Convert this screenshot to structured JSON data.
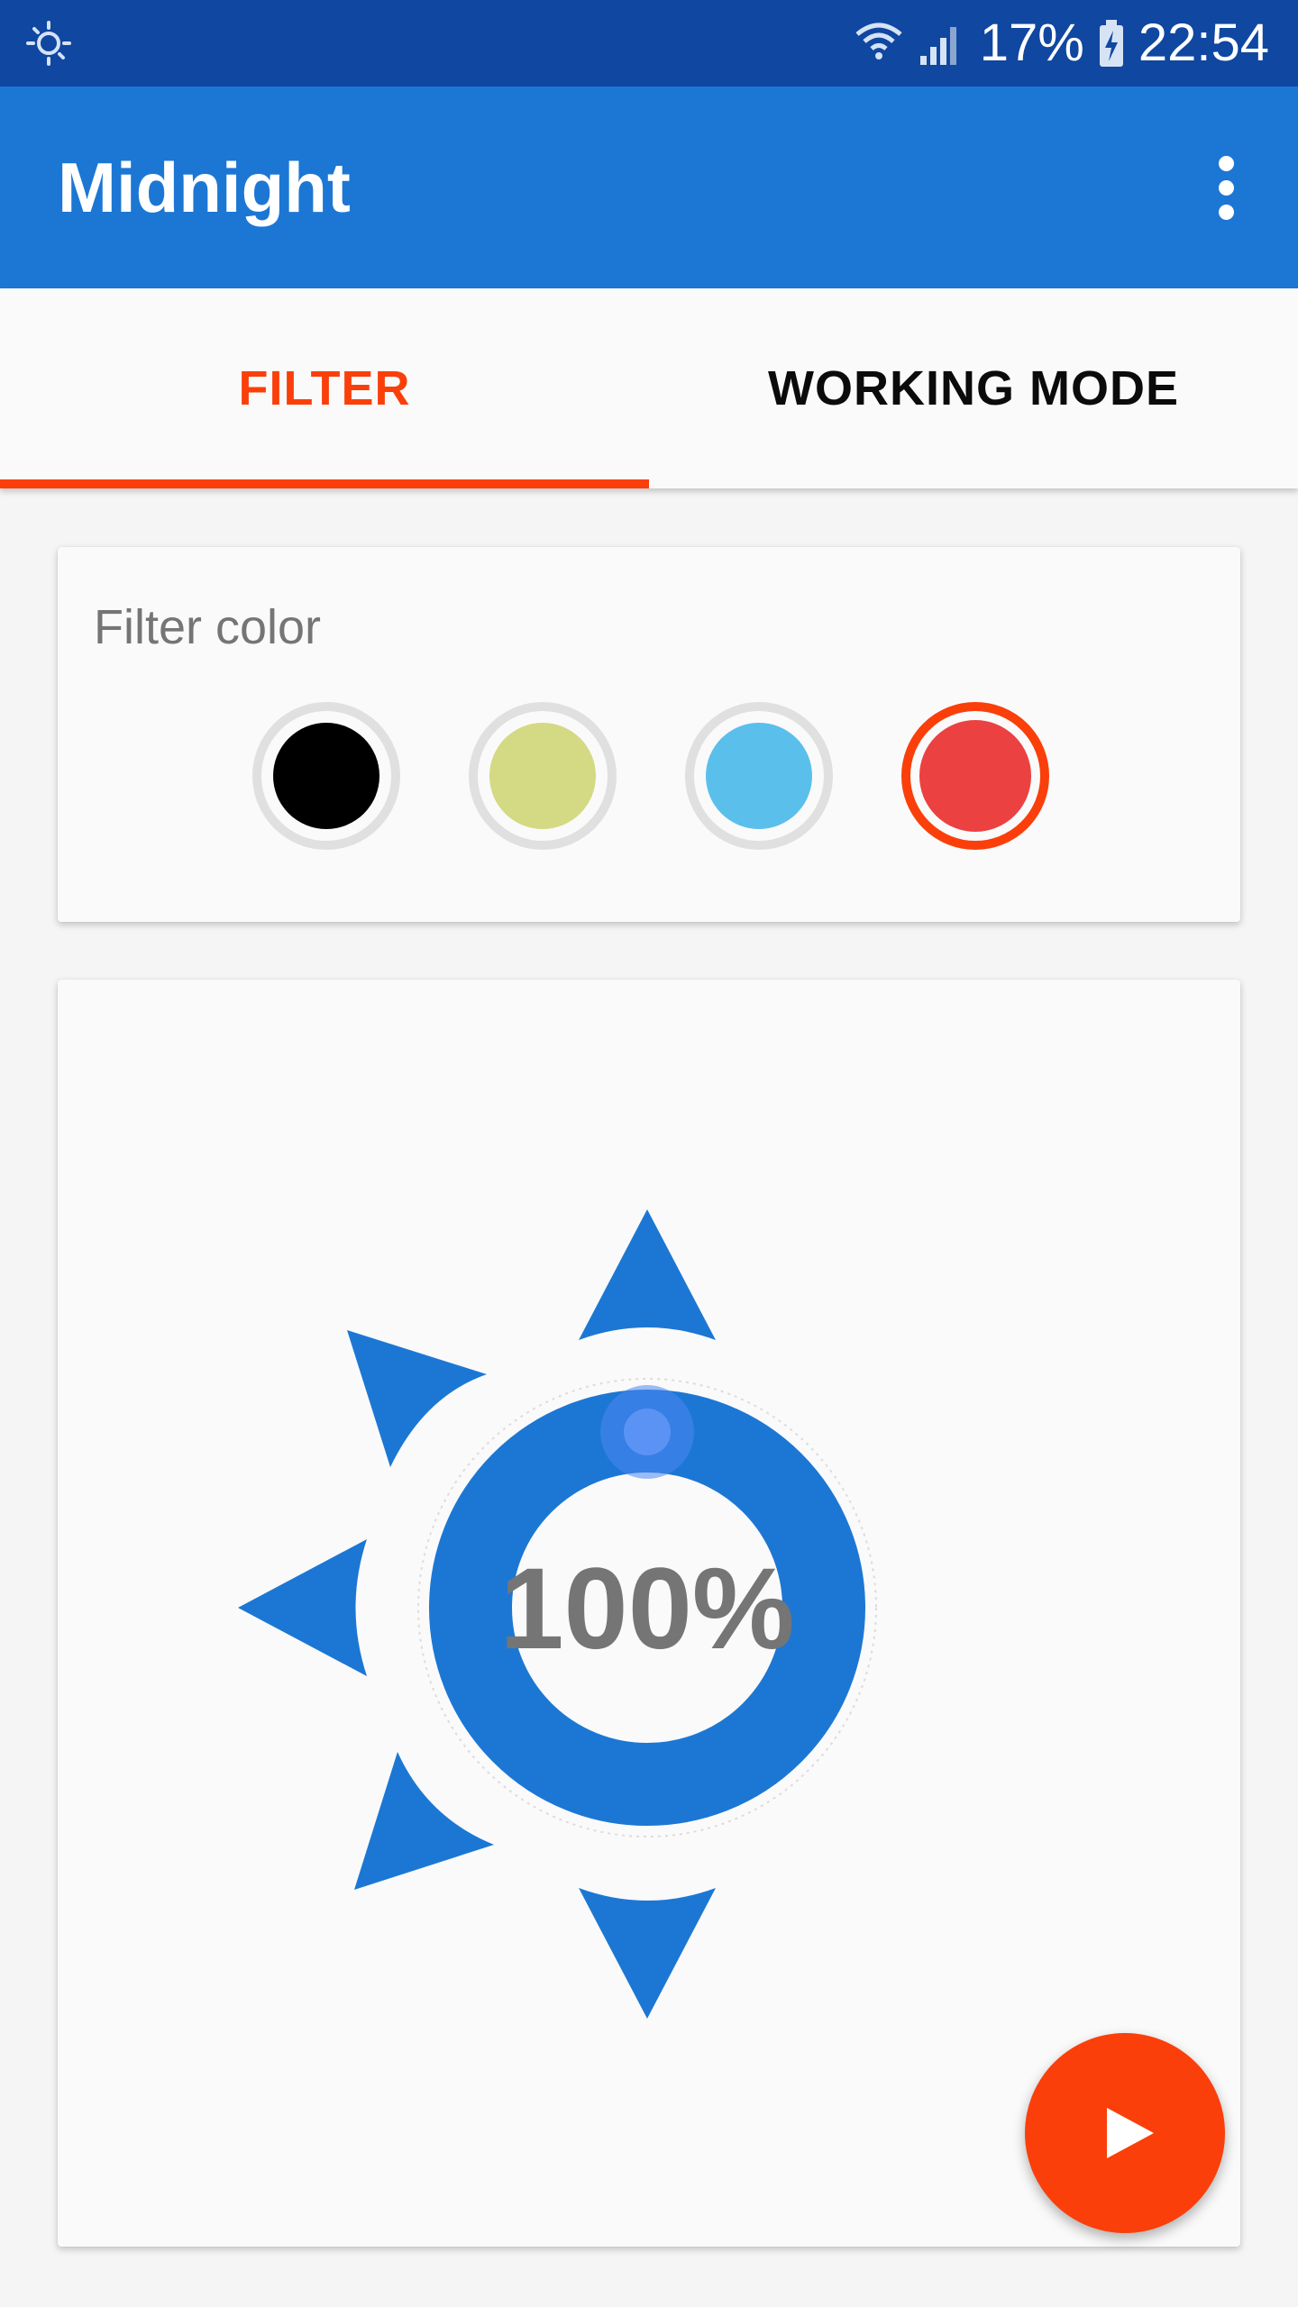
{
  "status_bar": {
    "battery": "17%",
    "time": "22:54",
    "icons": [
      "brightness-icon",
      "wifi-icon",
      "cellular-signal-icon",
      "battery-charging-icon"
    ]
  },
  "app_bar": {
    "title": "Midnight",
    "menu_icon": "more-vert-icon"
  },
  "tabs": [
    {
      "label": "FILTER",
      "selected": true
    },
    {
      "label": "WORKING MODE",
      "selected": false
    }
  ],
  "filter_color": {
    "title": "Filter color",
    "swatches": [
      {
        "name": "black",
        "color": "#000000",
        "selected": false
      },
      {
        "name": "yellow",
        "color": "#d4d984",
        "selected": false
      },
      {
        "name": "blue",
        "color": "#5bbfec",
        "selected": false
      },
      {
        "name": "red",
        "color": "#ec4141",
        "selected": true
      }
    ]
  },
  "intensity": {
    "value_text": "100%",
    "value": 1.0
  },
  "fab": {
    "icon": "play-icon"
  },
  "colors": {
    "primary": "#1c77d4",
    "primary_dark": "#0f47a1",
    "accent": "#fa3f0b"
  }
}
